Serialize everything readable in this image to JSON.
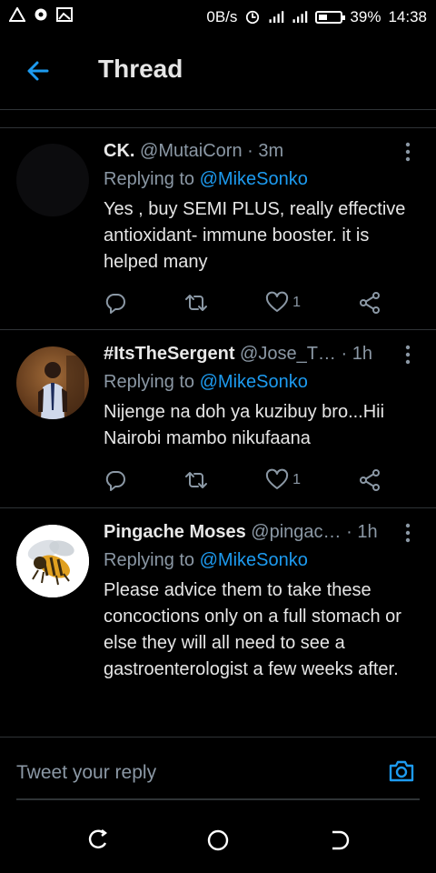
{
  "status": {
    "network_speed": "0B/s",
    "battery": "39%",
    "time": "14:38",
    "battery_level": 0.39
  },
  "header": {
    "title": "Thread"
  },
  "tweets": [
    {
      "name": "CK.",
      "handle": "@MutaiCorn",
      "separator": "·",
      "time": "3m",
      "replying_prefix": "Replying to",
      "replying_to": "@MikeSonko",
      "text": "Yes , buy SEMI PLUS, really effective antioxidant- immune booster. it is helped many",
      "likes": "1"
    },
    {
      "name": "#ItsTheSergent",
      "handle": "@Jose_T…",
      "separator": "·",
      "time": "1h",
      "replying_prefix": "Replying to",
      "replying_to": "@MikeSonko",
      "text": "Nijenge na doh ya kuzibuy bro...Hii Nairobi mambo nikufaana",
      "likes": "1"
    },
    {
      "name": "Pingache Moses",
      "handle": "@pingac…",
      "separator": "·",
      "time": "1h",
      "replying_prefix": "Replying to",
      "replying_to": "@MikeSonko",
      "text": "Please advice them to take these concoctions only on a full stomach or else they will all need to see a gastroenterologist a few weeks after."
    }
  ],
  "composer": {
    "placeholder": "Tweet your reply"
  },
  "icons": {
    "back": "arrow-left-icon",
    "more": "more-vertical-icon",
    "reply": "reply-icon",
    "retweet": "retweet-icon",
    "like": "heart-icon",
    "share": "share-icon",
    "camera": "camera-icon"
  },
  "colors": {
    "accent": "#1d9bf0",
    "background": "#000000",
    "muted": "#8b98a5"
  }
}
